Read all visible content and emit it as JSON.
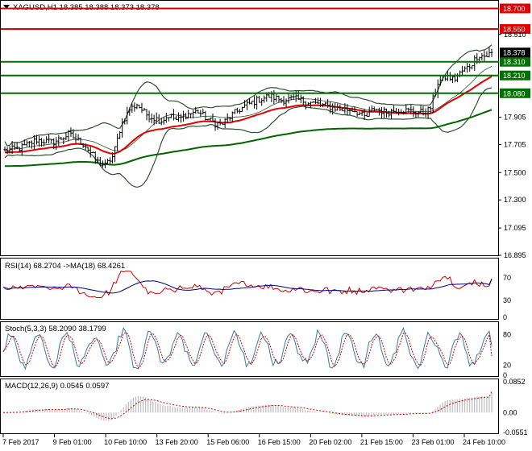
{
  "window": {
    "symbol_line": "XAGUSD,H1  18.385 18.388 18.373 18.378"
  },
  "colors": {
    "price": "#000000",
    "bollinger": "#2f4f2f",
    "ma_fast": "#e00000",
    "ma_slow": "#006400",
    "resistance": "#e00000",
    "support": "#007000",
    "rsi": "#cc0000",
    "rsi_ma": "#000080",
    "stoch_main": "#3a7a9a",
    "stoch_signal": "#cc0000",
    "macd_hist": "#c0c0c0",
    "macd_signal": "#cc0000",
    "current_price_tag": "#000000"
  },
  "chart_data": [
    {
      "type": "candlestick",
      "panel": "price",
      "symbol": "XAGUSD",
      "timeframe": "H1",
      "ylim": [
        16.895,
        18.75
      ],
      "y_ticks": [
        "18.510",
        "17.905",
        "17.705",
        "17.500",
        "17.300",
        "17.095",
        "16.895"
      ],
      "x_ticks": [
        "7 Feb 2017",
        "9 Feb 01:00",
        "10 Feb 10:00",
        "13 Feb 20:00",
        "15 Feb 06:00",
        "16 Feb 15:00",
        "20 Feb 02:00",
        "21 Feb 15:00",
        "23 Feb 01:00",
        "24 Feb 10:00"
      ],
      "close_profile": [
        [
          0,
          17.66
        ],
        [
          20,
          17.68
        ],
        [
          40,
          17.74
        ],
        [
          60,
          17.72
        ],
        [
          80,
          17.78
        ],
        [
          100,
          17.7
        ],
        [
          115,
          17.58
        ],
        [
          125,
          17.55
        ],
        [
          135,
          17.62
        ],
        [
          145,
          17.85
        ],
        [
          155,
          17.96
        ],
        [
          165,
          18.0
        ],
        [
          175,
          17.93
        ],
        [
          185,
          17.9
        ],
        [
          195,
          17.88
        ],
        [
          205,
          17.92
        ],
        [
          215,
          17.88
        ],
        [
          225,
          17.92
        ],
        [
          240,
          17.95
        ],
        [
          255,
          17.88
        ],
        [
          270,
          17.85
        ],
        [
          285,
          17.93
        ],
        [
          300,
          17.99
        ],
        [
          315,
          18.03
        ],
        [
          330,
          18.06
        ],
        [
          345,
          18.03
        ],
        [
          360,
          18.04
        ],
        [
          375,
          18.02
        ],
        [
          390,
          18.0
        ],
        [
          405,
          17.98
        ],
        [
          420,
          17.96
        ],
        [
          435,
          17.96
        ],
        [
          450,
          17.9
        ],
        [
          460,
          17.97
        ],
        [
          475,
          17.94
        ],
        [
          490,
          17.96
        ],
        [
          505,
          17.95
        ],
        [
          520,
          17.94
        ],
        [
          530,
          17.96
        ],
        [
          540,
          18.16
        ],
        [
          550,
          18.2
        ],
        [
          560,
          18.18
        ],
        [
          570,
          18.24
        ],
        [
          580,
          18.28
        ],
        [
          590,
          18.36
        ],
        [
          600,
          18.35
        ],
        [
          607,
          18.38
        ]
      ],
      "moving_averages": [
        {
          "name": "MA fast",
          "color": "#e00000"
        },
        {
          "name": "MA slow",
          "color": "#006400"
        }
      ],
      "horizontal_levels": [
        {
          "value": 18.7,
          "label": "18.700",
          "kind": "resistance"
        },
        {
          "value": 18.55,
          "label": "18.550",
          "kind": "resistance"
        },
        {
          "value": 18.31,
          "label": "18.310",
          "kind": "support"
        },
        {
          "value": 18.21,
          "label": "18.210",
          "kind": "support"
        },
        {
          "value": 18.08,
          "label": "18.080",
          "kind": "support"
        }
      ],
      "current_price": {
        "value": 18.378,
        "label": "18.378"
      }
    },
    {
      "type": "line",
      "panel": "rsi",
      "title": "RSI(14) 68.2704  ->MA(18) 68.4261",
      "ylim": [
        0,
        100
      ],
      "y_ticks": [
        "70",
        "30",
        "0"
      ],
      "series": [
        {
          "name": "RSI(14)",
          "color": "#cc0000",
          "last": 68.2704
        },
        {
          "name": "MA(18)",
          "color": "#000080",
          "last": 68.4261
        }
      ]
    },
    {
      "type": "line",
      "panel": "stochastic",
      "title": "Stoch(5,3,3) 58.2090 38.1799",
      "ylim": [
        0,
        100
      ],
      "y_ticks": [
        "80",
        "20",
        "0"
      ],
      "series": [
        {
          "name": "Main",
          "color": "#3a7a9a",
          "last": 58.209
        },
        {
          "name": "Signal",
          "color": "#cc0000",
          "last": 38.1799
        }
      ]
    },
    {
      "type": "bar",
      "panel": "macd",
      "title": "MACD(12,26,9) 0.0545 0.0597",
      "ylim": [
        -0.0551,
        0.0852
      ],
      "y_ticks": [
        "0.0852",
        "0.00",
        "-0.0551"
      ],
      "series": [
        {
          "name": "MACD",
          "color": "#c0c0c0",
          "last": 0.0545
        },
        {
          "name": "Signal",
          "color": "#cc0000",
          "last": 0.0597
        }
      ]
    }
  ]
}
